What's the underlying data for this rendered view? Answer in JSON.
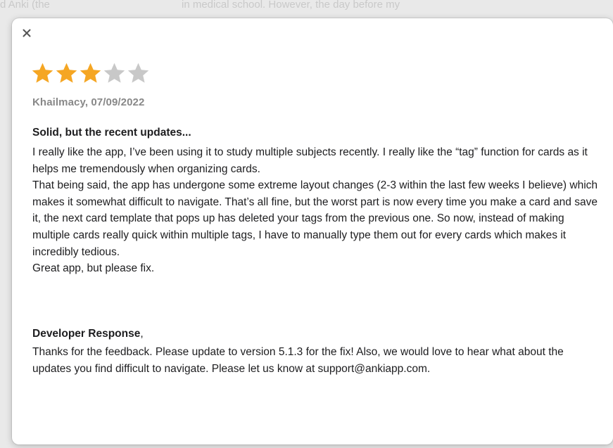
{
  "background": {
    "left_text": "d Anki (the",
    "right_text": "in medical school. However, the day before my"
  },
  "modal": {
    "close_icon": "close-icon",
    "rating": {
      "value": 3,
      "max": 5,
      "filled_color": "#f5a623",
      "empty_color": "#c8c8c8"
    },
    "reviewer_line": "Khailmacy, 07/09/2022",
    "review_title": "Solid, but the recent updates...",
    "review_paragraphs": [
      "I really like the app, I’ve been using it to study multiple subjects recently. I really like the “tag” function for cards as it helps me tremendously when organizing cards.",
      "That being said, the app has undergone some extreme layout changes (2-3 within the last few weeks I believe) which makes it somewhat difficult to navigate. That’s all fine, but the worst part is now every time you make a card and save it, the next card template that pops up has deleted your tags from the previous one. So now, instead of making multiple cards really quick within multiple tags, I have to manually type them out for every cards which makes it incredibly tedious.",
      "Great app, but please fix."
    ],
    "developer_response_label": "Developer Response",
    "developer_response_suffix": ",",
    "developer_response_text": "Thanks for the feedback. Please update to version 5.1.3 for the fix! Also, we would love to hear what about the updates you find difficult to navigate. Please let us know at support@ankiapp.com."
  }
}
